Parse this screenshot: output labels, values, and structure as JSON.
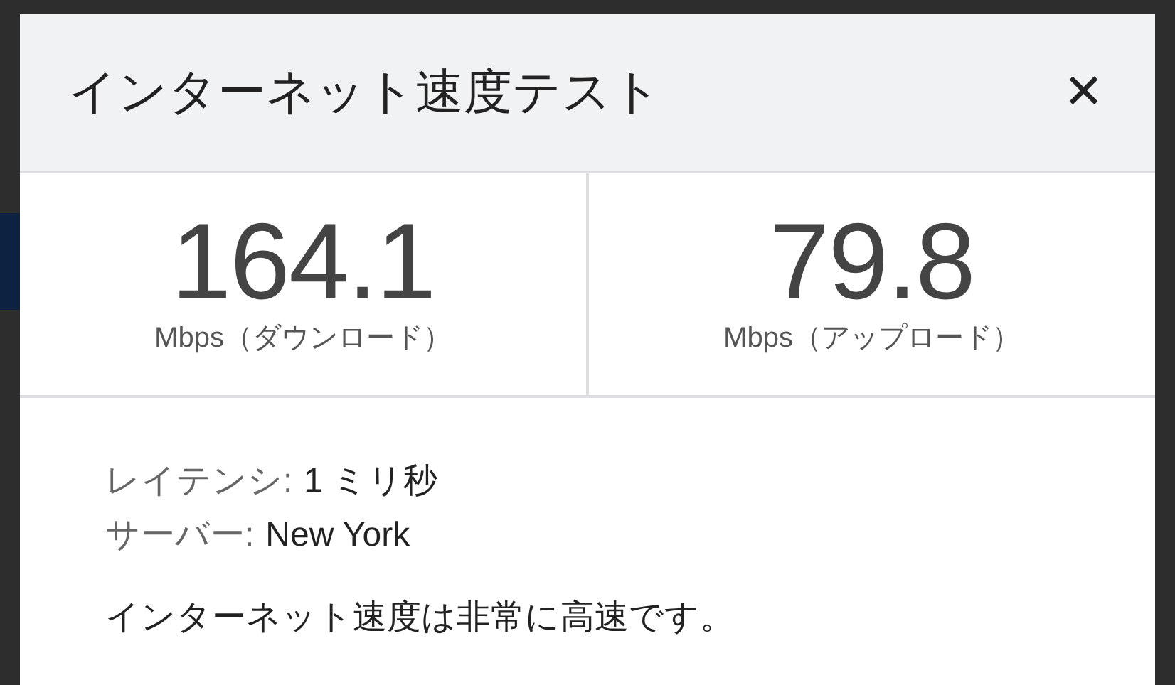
{
  "dialog": {
    "title": "インターネット速度テスト",
    "close": "✕",
    "stats": [
      {
        "value": "164.1",
        "label": "Mbps（ダウンロード）"
      },
      {
        "value": "79.8",
        "label": "Mbps（アップロード）"
      }
    ],
    "details": [
      {
        "label": "レイテンシ:",
        "value": "1 ミリ秒"
      },
      {
        "label": "サーバー:",
        "value": "New York"
      }
    ],
    "message": "インターネット速度は非常に高速です。"
  }
}
